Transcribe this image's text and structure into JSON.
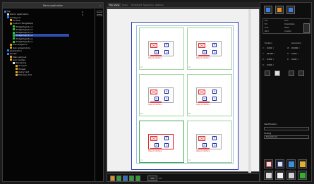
{
  "left_panel": {
    "title": "Demo application",
    "close_glyph": "x",
    "tree": [
      {
        "label": "Top",
        "indent": 0,
        "color": "#2f7de0"
      },
      {
        "label": "Demo application",
        "indent": 1,
        "color": "#e0e0e0"
      },
      {
        "label": "Sublayout",
        "indent": 1,
        "color": "#2f7de0"
      },
      {
        "label": "Ui Files",
        "indent": 2,
        "color": "#e0a020"
      },
      {
        "label": "Custom WidgetApp",
        "indent": 2,
        "color": "#e0a020"
      },
      {
        "label": "WidgetApp(1).ui",
        "indent": 3,
        "color": "#30c030"
      },
      {
        "label": "WidgetApp(2).ui",
        "indent": 3,
        "color": "#30c030"
      },
      {
        "label": "WidgetApp(3).ui",
        "indent": 3,
        "color": "#30c030"
      },
      {
        "label": "WidgetApp(4).ui",
        "indent": 3,
        "color": "#30c030",
        "selected": true
      },
      {
        "label": "WidgetApp(5).ui",
        "indent": 3,
        "color": "#30c030"
      },
      {
        "label": "WidgetApp(6).ui",
        "indent": 3,
        "color": "#30c030"
      },
      {
        "label": "Sub widget.ui",
        "indent": 2,
        "color": "#e0a020"
      },
      {
        "label": "Sub widget style",
        "indent": 2,
        "color": "#e0a020"
      },
      {
        "label": "Application",
        "indent": 1,
        "color": "#2f7de0"
      },
      {
        "label": "Toolkit",
        "indent": 1,
        "color": "#2f7de0"
      },
      {
        "label": "Main window",
        "indent": 2,
        "color": "#e0a020"
      },
      {
        "label": "Icon toolbar",
        "indent": 2,
        "color": "#e0a020"
      },
      {
        "label": "Rendering",
        "indent": 3,
        "color": "#e0e0e0"
      },
      {
        "label": "Grouper",
        "indent": 4,
        "color": "#e0a020"
      },
      {
        "label": "Widget",
        "indent": 4,
        "color": "#e0a020"
      },
      {
        "label": "Apply test",
        "indent": 4,
        "color": "#e0a020"
      },
      {
        "label": "Manage_Tool",
        "indent": 4,
        "color": "#e0a020"
      }
    ],
    "counts": {
      "row1": "0",
      "row2": "2"
    }
  },
  "tabs": [
    {
      "label": "Top plane",
      "active": true
    },
    {
      "label": "Lines",
      "active": false
    },
    {
      "label": "Ornament",
      "active": false
    },
    {
      "label": "Specimen",
      "active": false
    },
    {
      "label": "Options",
      "active": false
    }
  ],
  "canvas": {
    "cells": [
      {
        "label": "Object interface",
        "tag": "A1"
      },
      {
        "label": "Object interface",
        "tag": "A2"
      },
      {
        "label": "Object interface",
        "tag": "B1"
      },
      {
        "label": "Object interface",
        "tag": "B2"
      },
      {
        "label": "Object interface",
        "tag": "C1",
        "highlight": true
      },
      {
        "label": "Object interface",
        "tag": "C2"
      }
    ]
  },
  "status": {
    "zoom": "100",
    "zoom_unit": "0%"
  },
  "right_panel": {
    "list": [
      {
        "label": "Top",
        "value": "Grid"
      },
      {
        "label": "Fill",
        "value": "Orientation"
      },
      {
        "label": "Line",
        "value": "Wide"
      },
      {
        "label": "Rect",
        "value": "Custom"
      }
    ],
    "headers": {
      "left": "Position",
      "right": "Geometry"
    },
    "spins": [
      {
        "label": "X:",
        "value": "0.000",
        "right_label": "W:",
        "right_value": "20.000"
      },
      {
        "label": "Y:",
        "value": "44.000",
        "right_label": "H:",
        "right_value": "0.000"
      },
      {
        "label": "Z:",
        "value": "0.000",
        "right_label": "R:",
        "right_value": "0.000"
      },
      {
        "label": "R:",
        "value": "0.000",
        "right_label": "",
        "right_value": ""
      }
    ],
    "section_label": "Identification",
    "name_value": "",
    "scaling_label": "Scaling",
    "scaling_value": "Proportional"
  }
}
